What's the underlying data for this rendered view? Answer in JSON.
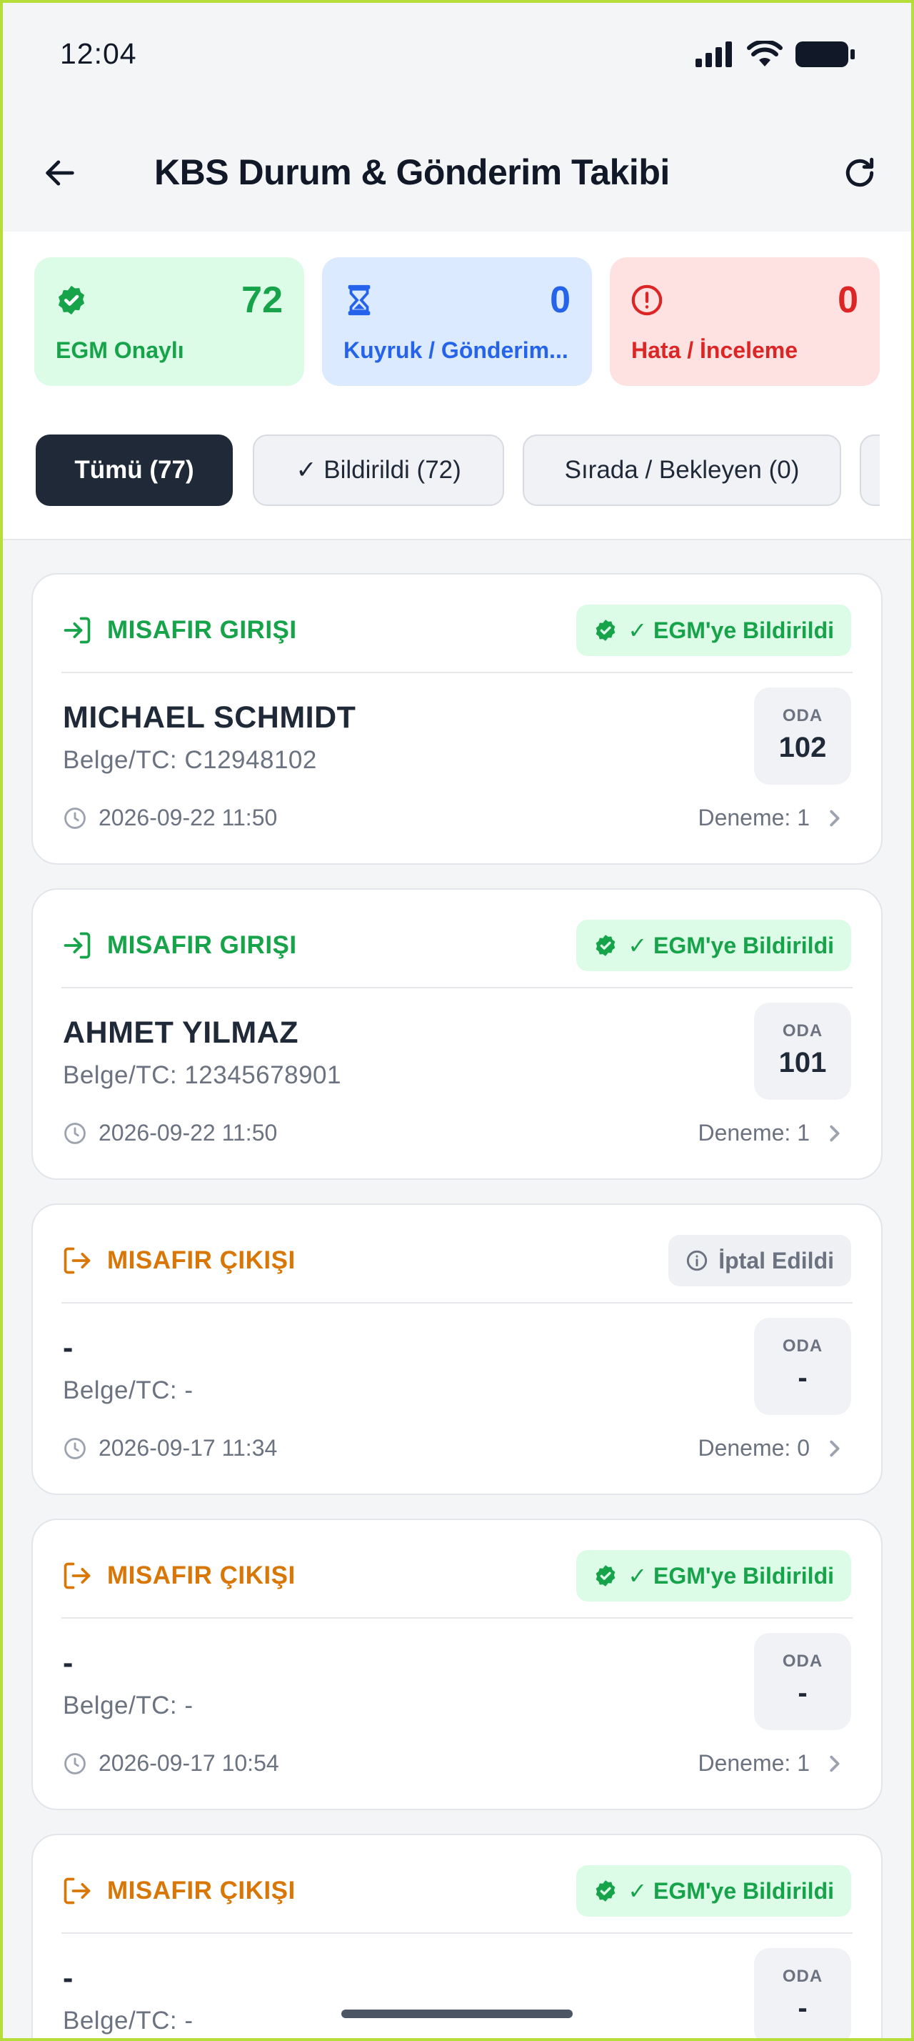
{
  "status_bar": {
    "time": "12:04"
  },
  "header": {
    "title": "KBS Durum & Gönderim Takibi"
  },
  "stats": [
    {
      "value": "72",
      "label": "EGM Onaylı",
      "icon": "verified-badge-icon"
    },
    {
      "value": "0",
      "label": "Kuyruk / Gönderim...",
      "icon": "hourglass-icon"
    },
    {
      "value": "0",
      "label": "Hata / İnceleme",
      "icon": "alert-circle-icon"
    }
  ],
  "filters": [
    {
      "label": "Tümü (77)",
      "active": true
    },
    {
      "label": "✓ Bildirildi (72)",
      "active": false
    },
    {
      "label": "Sırada / Bekleyen (0)",
      "active": false
    }
  ],
  "records": [
    {
      "type": "MISAFIR GIRIŞI",
      "direction": "in",
      "status": "✓ EGM'ye Bildirildi",
      "status_kind": "ok",
      "name": "MICHAEL SCHMIDT",
      "doc": "Belge/TC: C12948102",
      "room_label": "ODA",
      "room": "102",
      "time": "2026-09-22 11:50",
      "attempt": "Deneme: 1"
    },
    {
      "type": "MISAFIR GIRIŞI",
      "direction": "in",
      "status": "✓ EGM'ye Bildirildi",
      "status_kind": "ok",
      "name": "AHMET YILMAZ",
      "doc": "Belge/TC: 12345678901",
      "room_label": "ODA",
      "room": "101",
      "time": "2026-09-22 11:50",
      "attempt": "Deneme: 1"
    },
    {
      "type": "MISAFIR ÇIKIŞI",
      "direction": "out",
      "status": "İptal Edildi",
      "status_kind": "cancel",
      "name": "-",
      "doc": "Belge/TC: -",
      "room_label": "ODA",
      "room": "-",
      "time": "2026-09-17 11:34",
      "attempt": "Deneme: 0"
    },
    {
      "type": "MISAFIR ÇIKIŞI",
      "direction": "out",
      "status": "✓ EGM'ye Bildirildi",
      "status_kind": "ok",
      "name": "-",
      "doc": "Belge/TC: -",
      "room_label": "ODA",
      "room": "-",
      "time": "2026-09-17 10:54",
      "attempt": "Deneme: 1"
    },
    {
      "type": "MISAFIR ÇIKIŞI",
      "direction": "out",
      "status": "✓ EGM'ye Bildirildi",
      "status_kind": "ok",
      "name": "-",
      "doc": "Belge/TC: -",
      "room_label": "ODA",
      "room": "-",
      "time": "",
      "attempt": ""
    }
  ],
  "colors": {
    "success": "#16a34a",
    "info": "#2563eb",
    "danger": "#dc2626",
    "warning": "#d97706",
    "dark": "#1f2937"
  }
}
